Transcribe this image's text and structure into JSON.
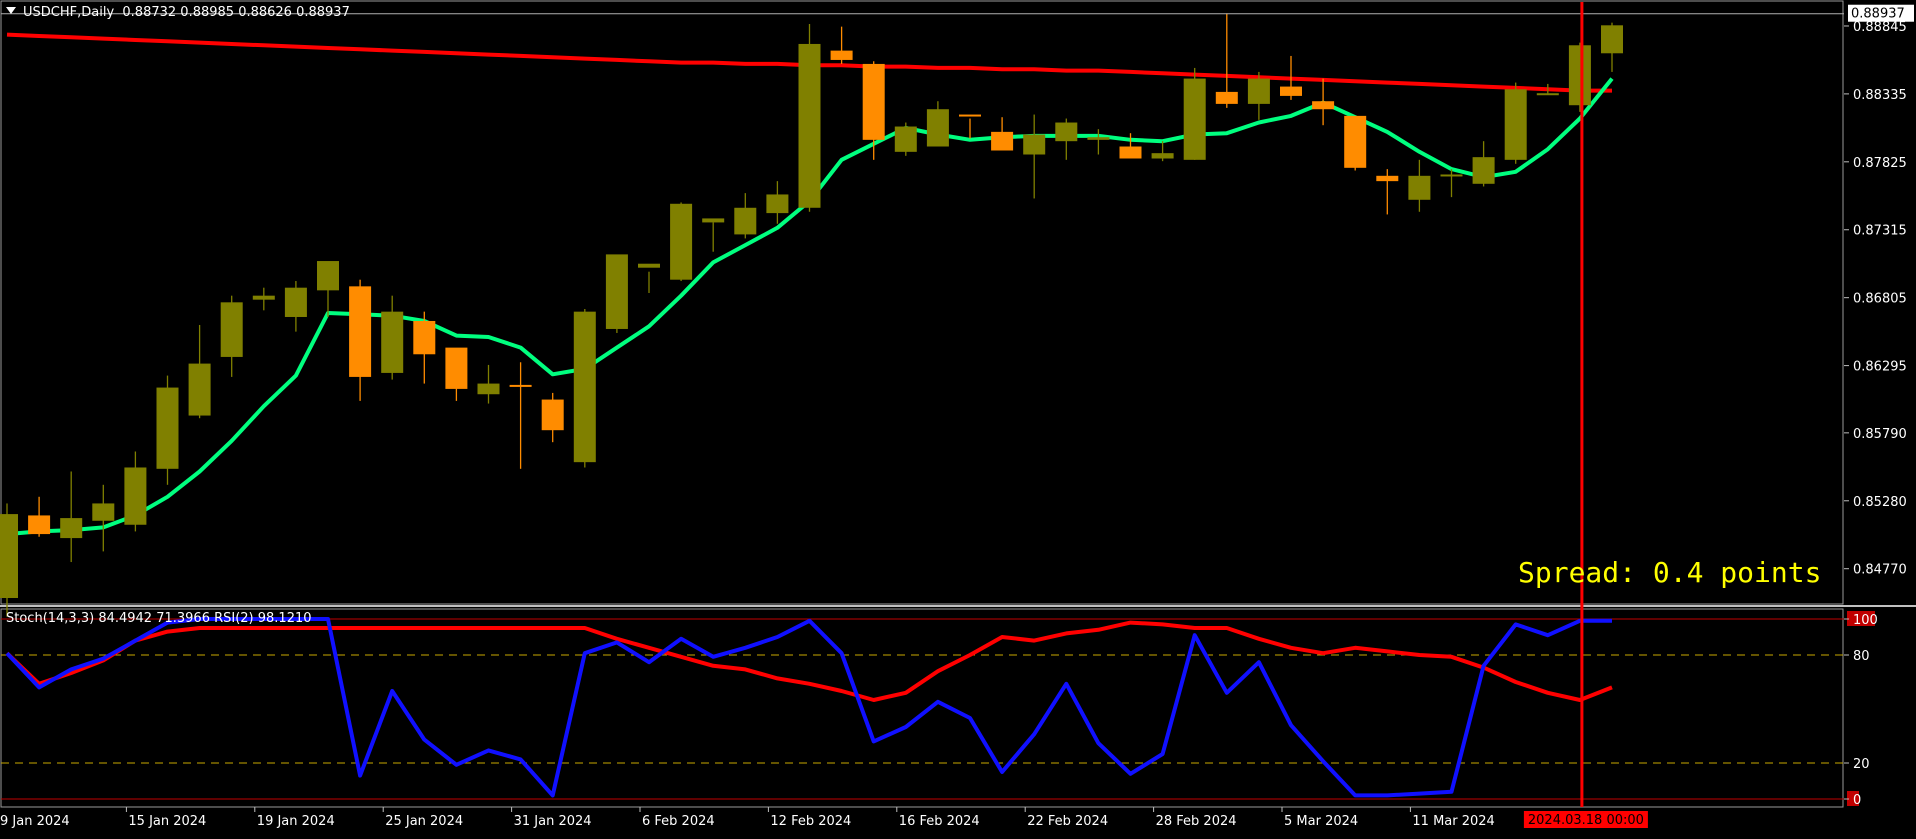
{
  "header": {
    "symbol_label": "USDCHF,Daily",
    "ohlc_label": "0.88732 0.88985 0.88626 0.88937"
  },
  "indicator_header": {
    "label": "Stoch(14,3,3) 84.4942 71.3966  RSI(2) 98.1210"
  },
  "spread_text": "Spread: 0.4 points",
  "current_price_label": "0.88937",
  "crosshair_date_label": "2024.03.18 00:00",
  "colors": {
    "background": "#000000",
    "bull_candle": "#808000",
    "bear_candle": "#ff8c00",
    "ma_slow": "#ff0000",
    "ma_fast": "#00ff7f",
    "stoch_line": "#1010ff",
    "rsi_line": "#ff0000",
    "crosshair": "#ff0000",
    "spread_text": "#ffff00",
    "level_line": "#c8a800"
  },
  "chart_data": [
    {
      "type": "candlestick",
      "title": "USDCHF,Daily",
      "ylim": [
        0.8452,
        0.8901
      ],
      "y_ticks": [
        "0.88845",
        "0.88335",
        "0.87825",
        "0.87315",
        "0.86805",
        "0.86295",
        "0.85790",
        "0.85280",
        "0.84770"
      ],
      "y_tick_values": [
        0.88845,
        0.88335,
        0.87825,
        0.87315,
        0.86805,
        0.86295,
        0.8579,
        0.8528,
        0.8477
      ],
      "x_tick_labels": [
        "9 Jan 2024",
        "15 Jan 2024",
        "19 Jan 2024",
        "25 Jan 2024",
        "31 Jan 2024",
        "6 Feb 2024",
        "12 Feb 2024",
        "16 Feb 2024",
        "22 Feb 2024",
        "28 Feb 2024",
        "5 Mar 2024",
        "11 Mar 2024"
      ],
      "x_tick_bar_index": [
        0,
        4,
        8,
        12,
        16,
        20,
        24,
        28,
        32,
        36,
        40,
        44
      ],
      "candles": [
        [
          0.8455,
          0.8526,
          0.8441,
          0.8518
        ],
        [
          0.8517,
          0.8531,
          0.8501,
          0.8503
        ],
        [
          0.85,
          0.855,
          0.8482,
          0.8515
        ],
        [
          0.8513,
          0.854,
          0.849,
          0.8526
        ],
        [
          0.851,
          0.8565,
          0.8505,
          0.8553
        ],
        [
          0.8552,
          0.8622,
          0.854,
          0.8613
        ],
        [
          0.8592,
          0.866,
          0.859,
          0.8631
        ],
        [
          0.8636,
          0.8682,
          0.8621,
          0.8677
        ],
        [
          0.8679,
          0.8688,
          0.8671,
          0.8682
        ],
        [
          0.8666,
          0.8693,
          0.8655,
          0.8688
        ],
        [
          0.8686,
          0.8707,
          0.8666,
          0.8708
        ],
        [
          0.8689,
          0.8694,
          0.8603,
          0.8621
        ],
        [
          0.8624,
          0.8682,
          0.8619,
          0.867
        ],
        [
          0.8663,
          0.867,
          0.8616,
          0.8638
        ],
        [
          0.8643,
          0.8641,
          0.8603,
          0.8612
        ],
        [
          0.8608,
          0.863,
          0.8601,
          0.8616
        ],
        [
          0.8615,
          0.8632,
          0.8552,
          0.8614
        ],
        [
          0.8604,
          0.8609,
          0.8572,
          0.8581
        ],
        [
          0.8557,
          0.8672,
          0.8553,
          0.867
        ],
        [
          0.8657,
          0.8702,
          0.8654,
          0.8713
        ],
        [
          0.8703,
          0.87,
          0.8684,
          0.8706
        ],
        [
          0.8694,
          0.8752,
          0.8693,
          0.8751
        ],
        [
          0.8737,
          0.8737,
          0.8715,
          0.874
        ],
        [
          0.8728,
          0.8759,
          0.8725,
          0.8748
        ],
        [
          0.8744,
          0.8768,
          0.8736,
          0.8758
        ],
        [
          0.8748,
          0.8886,
          0.8745,
          0.8871
        ],
        [
          0.8866,
          0.8884,
          0.8856,
          0.8859
        ],
        [
          0.8856,
          0.8858,
          0.8784,
          0.8799
        ],
        [
          0.879,
          0.8812,
          0.8787,
          0.8809
        ],
        [
          0.8794,
          0.8828,
          0.8794,
          0.8822
        ],
        [
          0.8818,
          0.8815,
          0.88,
          0.8817
        ],
        [
          0.8805,
          0.8816,
          0.8795,
          0.8791
        ],
        [
          0.8788,
          0.8818,
          0.8755,
          0.8803
        ],
        [
          0.8798,
          0.8815,
          0.8784,
          0.8812
        ],
        [
          0.8799,
          0.8807,
          0.8788,
          0.8801
        ],
        [
          0.8794,
          0.8804,
          0.8789,
          0.8785
        ],
        [
          0.8785,
          0.8798,
          0.8783,
          0.8789
        ],
        [
          0.8784,
          0.8853,
          0.8784,
          0.8845
        ],
        [
          0.8835,
          0.8894,
          0.8823,
          0.8826
        ],
        [
          0.8826,
          0.885,
          0.8814,
          0.8845
        ],
        [
          0.8839,
          0.8862,
          0.8829,
          0.8832
        ],
        [
          0.8828,
          0.8845,
          0.881,
          0.8822
        ],
        [
          0.8817,
          0.8803,
          0.8776,
          0.8778
        ],
        [
          0.8772,
          0.8777,
          0.8743,
          0.8768
        ],
        [
          0.8754,
          0.8784,
          0.8745,
          0.8772
        ],
        [
          0.8772,
          0.8777,
          0.8756,
          0.8773
        ],
        [
          0.8766,
          0.8798,
          0.8764,
          0.8786
        ],
        [
          0.8784,
          0.8842,
          0.8781,
          0.8837
        ],
        [
          0.8834,
          0.8841,
          0.8833,
          0.8834
        ],
        [
          0.8825,
          0.8872,
          0.882,
          0.887
        ],
        [
          0.8864,
          0.8887,
          0.885,
          0.8885
        ]
      ],
      "series": [
        {
          "values": [
            0.8878,
            0.8877,
            0.8876,
            0.8875,
            0.8874,
            0.8873,
            0.8872,
            0.8871,
            0.887,
            0.8869,
            0.8868,
            0.8867,
            0.8866,
            0.8865,
            0.8864,
            0.8863,
            0.8862,
            0.8861,
            0.886,
            0.8859,
            0.8858,
            0.8857,
            0.8857,
            0.8856,
            0.8856,
            0.8855,
            0.8855,
            0.8854,
            0.8854,
            0.8853,
            0.8853,
            0.8852,
            0.8852,
            0.8851,
            0.8851,
            0.885,
            0.8849,
            0.8848,
            0.8847,
            0.8846,
            0.8845,
            0.8844,
            0.8843,
            0.8842,
            0.8841,
            0.884,
            0.8839,
            0.8838,
            0.8837,
            0.8836,
            0.8836
          ]
        },
        {
          "values": [
            0.8503,
            0.8505,
            0.8506,
            0.8508,
            0.8517,
            0.8531,
            0.855,
            0.8573,
            0.8599,
            0.8622,
            0.8669,
            0.8668,
            0.8667,
            0.8663,
            0.8652,
            0.8651,
            0.8643,
            0.8623,
            0.8627,
            0.8643,
            0.8659,
            0.8682,
            0.8707,
            0.872,
            0.8733,
            0.8753,
            0.8784,
            0.8796,
            0.8808,
            0.8803,
            0.8799,
            0.8801,
            0.8802,
            0.8802,
            0.8802,
            0.8799,
            0.8798,
            0.8803,
            0.8804,
            0.8812,
            0.8817,
            0.8827,
            0.8816,
            0.8805,
            0.879,
            0.8777,
            0.8771,
            0.8775,
            0.8792,
            0.8815,
            0.8845
          ]
        }
      ],
      "crosshair_bar_index": 49,
      "current_price": 0.88937
    },
    {
      "type": "line",
      "title": "Stoch(14,3,3) 84.4942 71.3966  RSI(2) 98.1210",
      "ylim": [
        0,
        100
      ],
      "y_ticks": [
        "100",
        "80",
        "20",
        "0"
      ],
      "y_tick_values": [
        100,
        80,
        20,
        0
      ],
      "level_lines": [
        80,
        20
      ],
      "series": [
        {
          "values": [
            81,
            64,
            70,
            77,
            88,
            93,
            95,
            95,
            95,
            95,
            95,
            95,
            95,
            95,
            95,
            95,
            95,
            95,
            95,
            89,
            84,
            79,
            74,
            72,
            67,
            64,
            60,
            55,
            59,
            71,
            80,
            90,
            88,
            92,
            94,
            98,
            97,
            95,
            95,
            89,
            84,
            81,
            84,
            82,
            80,
            79,
            73,
            65,
            59,
            55,
            62
          ]
        },
        {
          "values": [
            81,
            62,
            72,
            78,
            88,
            98,
            100,
            100,
            100,
            100,
            100,
            13,
            60,
            33,
            19,
            27,
            22,
            2,
            81,
            87,
            76,
            89,
            79,
            84,
            90,
            99,
            81,
            32,
            40,
            54,
            45,
            15,
            36,
            64,
            31,
            14,
            25,
            91,
            59,
            76,
            41,
            21,
            2,
            2,
            3,
            4,
            74,
            97,
            91,
            99,
            99
          ]
        }
      ]
    }
  ]
}
